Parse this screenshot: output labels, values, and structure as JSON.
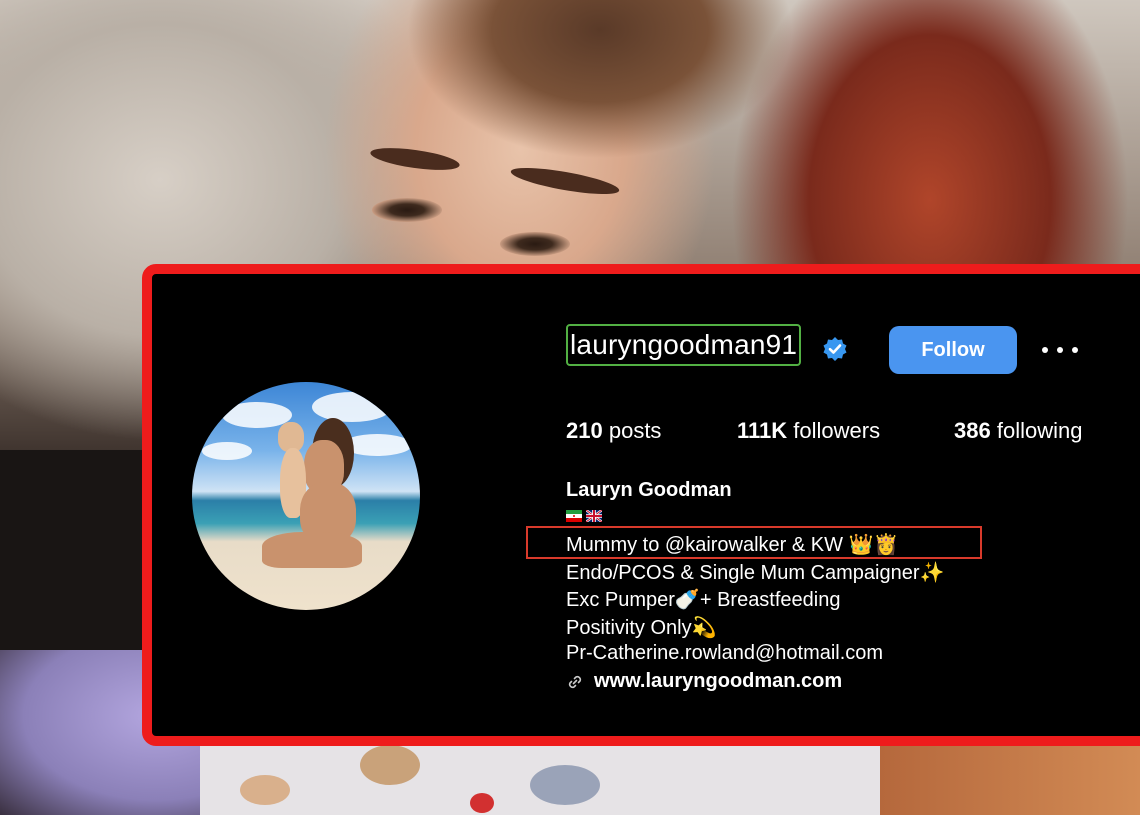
{
  "profile": {
    "username": "lauryngoodman91",
    "follow_label": "Follow",
    "stats": {
      "posts_count": "210",
      "posts_label": "posts",
      "followers_count": "111K",
      "followers_label": "followers",
      "following_count": "386",
      "following_label": "following"
    },
    "full_name": "Lauryn Goodman",
    "bio_lines": [
      "Mummy to @kairowalker & KW 👑👸",
      "Endo/PCOS & Single Mum Campaigner✨",
      "Exc Pumper🍼+ Breastfeeding",
      "Positivity Only💫",
      "Pr-Catherine.rowland@hotmail.com"
    ],
    "website": "www.lauryngoodman.com"
  },
  "colors": {
    "card_border": "#ee1c1c",
    "follow_button": "#4a95f0",
    "verified_badge": "#3897f0",
    "username_box": "#52b043",
    "highlight_box": "#d93a2b"
  },
  "icons": [
    "verified-badge-icon",
    "more-options-icon",
    "link-icon",
    "iran-flag-icon",
    "uk-flag-icon"
  ]
}
